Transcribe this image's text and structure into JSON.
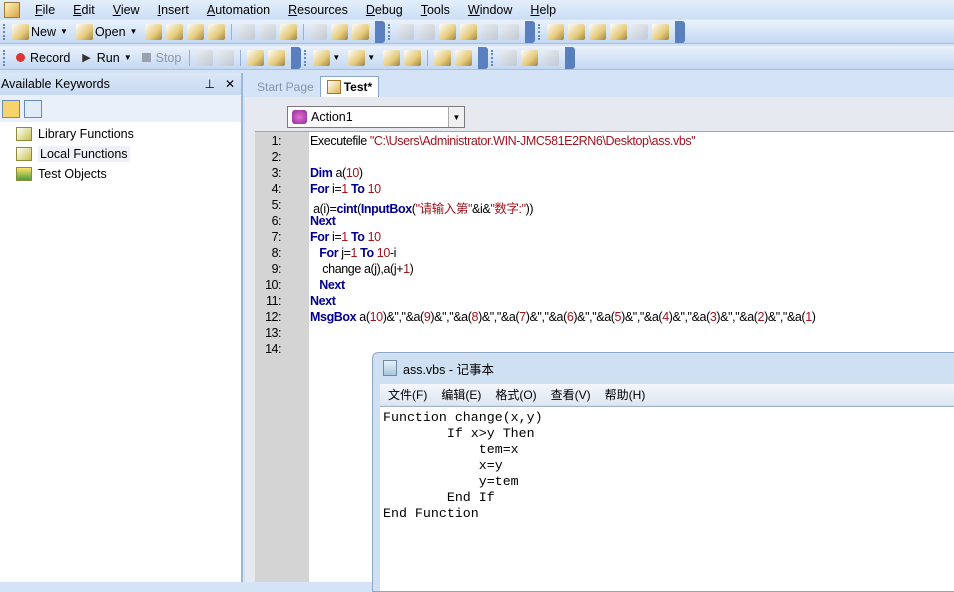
{
  "menubar": {
    "items": [
      "File",
      "Edit",
      "View",
      "Insert",
      "Automation",
      "Resources",
      "Debug",
      "Tools",
      "Window",
      "Help"
    ]
  },
  "toolbar1": {
    "new_label": "New",
    "open_label": "Open"
  },
  "toolbar2": {
    "record_label": "Record",
    "run_label": "Run",
    "stop_label": "Stop"
  },
  "left_panel": {
    "title": "Available Keywords",
    "pin_icon": "📌",
    "close": "✕",
    "items": [
      {
        "label": "Library Functions"
      },
      {
        "label": "Local Functions",
        "selected": true
      },
      {
        "label": "Test Objects"
      }
    ]
  },
  "tabs": [
    {
      "label": "Start Page",
      "active": false
    },
    {
      "label": "Test*",
      "active": true
    }
  ],
  "action_select": {
    "value": "Action1"
  },
  "editor": {
    "lines": [
      [
        [
          "plain",
          "Executefile "
        ],
        [
          "str",
          "\"C:\\Users\\Administrator.WIN-JMC581E2RN6\\Desktop\\ass.vbs\""
        ]
      ],
      [],
      [
        [
          "kw",
          "Dim"
        ],
        [
          "plain",
          " a("
        ],
        [
          "num",
          "10"
        ],
        [
          "plain",
          ")"
        ]
      ],
      [
        [
          "kw",
          "For"
        ],
        [
          "plain",
          " i="
        ],
        [
          "num",
          "1"
        ],
        [
          "plain",
          " "
        ],
        [
          "kw",
          "To"
        ],
        [
          "plain",
          " "
        ],
        [
          "num",
          "10"
        ]
      ],
      [
        [
          "plain",
          " a(i)="
        ],
        [
          "kw",
          "cint"
        ],
        [
          "plain",
          "("
        ],
        [
          "kw",
          "InputBox"
        ],
        [
          "plain",
          "("
        ],
        [
          "str",
          "\"请输入第\""
        ],
        [
          "plain",
          "&i&"
        ],
        [
          "str",
          "\"数字:\""
        ],
        [
          "plain",
          "))"
        ]
      ],
      [
        [
          "kw",
          "Next"
        ]
      ],
      [
        [
          "kw",
          "For"
        ],
        [
          "plain",
          " i="
        ],
        [
          "num",
          "1"
        ],
        [
          "plain",
          " "
        ],
        [
          "kw",
          "To"
        ],
        [
          "plain",
          " "
        ],
        [
          "num",
          "10"
        ]
      ],
      [
        [
          "plain",
          "   "
        ],
        [
          "kw",
          "For"
        ],
        [
          "plain",
          " j="
        ],
        [
          "num",
          "1"
        ],
        [
          "plain",
          " "
        ],
        [
          "kw",
          "To"
        ],
        [
          "plain",
          " "
        ],
        [
          "num",
          "10"
        ],
        [
          "plain",
          "-i"
        ]
      ],
      [
        [
          "plain",
          "    change a(j),a(j+"
        ],
        [
          "num",
          "1"
        ],
        [
          "plain",
          ")"
        ]
      ],
      [
        [
          "plain",
          "   "
        ],
        [
          "kw",
          "Next"
        ]
      ],
      [
        [
          "kw",
          "Next"
        ]
      ],
      [
        [
          "kw",
          "MsgBox"
        ],
        [
          "plain",
          " a("
        ],
        [
          "num",
          "10"
        ],
        [
          "plain",
          ")&\",\"&a("
        ],
        [
          "num",
          "9"
        ],
        [
          "plain",
          ")&\",\"&a("
        ],
        [
          "num",
          "8"
        ],
        [
          "plain",
          ")&\",\"&a("
        ],
        [
          "num",
          "7"
        ],
        [
          "plain",
          ")&\",\"&a("
        ],
        [
          "num",
          "6"
        ],
        [
          "plain",
          ")&\",\"&a("
        ],
        [
          "num",
          "5"
        ],
        [
          "plain",
          ")&\",\"&a("
        ],
        [
          "num",
          "4"
        ],
        [
          "plain",
          ")&\",\"&a("
        ],
        [
          "num",
          "3"
        ],
        [
          "plain",
          ")&\",\"&a("
        ],
        [
          "num",
          "2"
        ],
        [
          "plain",
          ")&\",\"&a("
        ],
        [
          "num",
          "1"
        ],
        [
          "plain",
          ")"
        ]
      ],
      [],
      []
    ]
  },
  "notepad": {
    "title": "ass.vbs - 记事本",
    "menu": [
      "文件(F)",
      "编辑(E)",
      "格式(O)",
      "查看(V)",
      "帮助(H)"
    ],
    "text": "Function change(x,y)\n        If x>y Then\n            tem=x\n            x=y\n            y=tem\n        End If\nEnd Function"
  }
}
